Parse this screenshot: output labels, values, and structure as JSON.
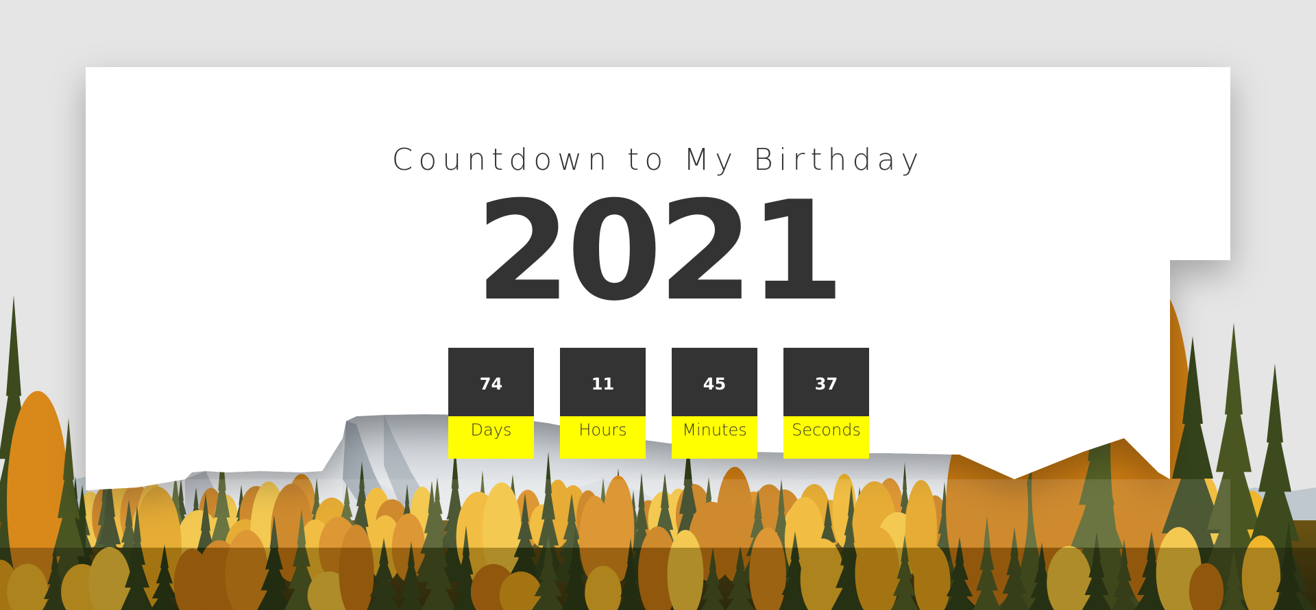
{
  "countdown": {
    "title": "Countdown to My Birthday",
    "year": "2021",
    "units": [
      {
        "value": "74",
        "label": "Days"
      },
      {
        "value": "11",
        "label": "Hours"
      },
      {
        "value": "45",
        "label": "Minutes"
      },
      {
        "value": "37",
        "label": "Seconds"
      }
    ]
  },
  "colors": {
    "background": "#e5e5e5",
    "card": "#ffffff",
    "text": "#333333",
    "number_box": "#333333",
    "label_box": "#ffff00"
  }
}
